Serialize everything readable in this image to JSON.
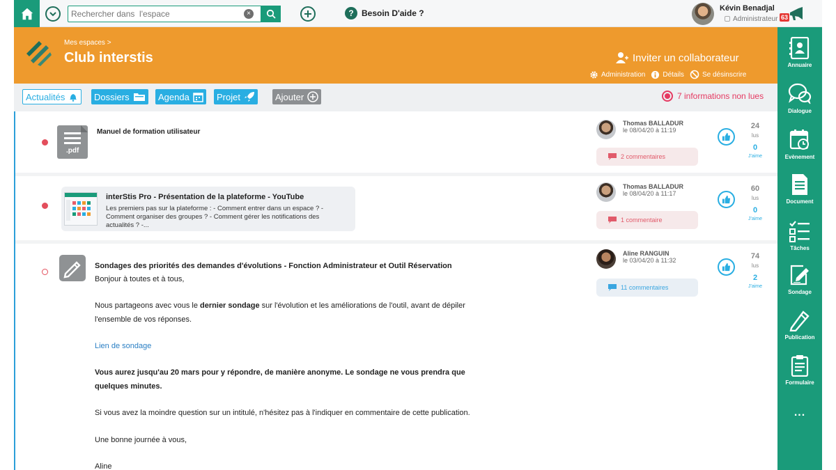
{
  "topbar": {
    "search_placeholder": "Rechercher dans  l'espace",
    "clear_symbol": "×",
    "help_symbol": "?",
    "help_label": "Besoin D'aide ?",
    "user_name": "Kévin Benadjal",
    "user_role": "Administrateur",
    "notification_count": "63"
  },
  "header": {
    "breadcrumb": "Mes espaces >",
    "title": "Club interstis",
    "invite_label": "Inviter un collaborateur",
    "links": [
      "Administration",
      "Détails",
      "Se désinscrire"
    ]
  },
  "tabs": {
    "items": [
      "Actualités",
      "Dossiers",
      "Agenda",
      "Projet",
      "Ajouter"
    ],
    "unread_label": "7 informations non lues"
  },
  "posts": [
    {
      "title": "Manuel de formation utilisateur",
      "file_ext": ".pdf",
      "author": "Thomas BALLADUR",
      "date": "le 08/04/20 à 11:19",
      "comments": "2 commentaires",
      "reads": "24",
      "reads_label": "lus",
      "likes": "0",
      "likes_label": "J'aime"
    },
    {
      "link_title": "interStis Pro - Présentation de la plateforme - YouTube",
      "link_desc": "Les premiers pas sur la plateforme : - Comment entrer dans un espace ? - Comment organiser des groupes ? - Comment gérer les notifications des actualités ? -...",
      "author": "Thomas BALLADUR",
      "date": "le 08/04/20 à 11:17",
      "comments": "1 commentaire",
      "reads": "60",
      "reads_label": "lus",
      "likes": "0",
      "likes_label": "J'aime"
    },
    {
      "title": "Sondages des priorités des demandes d'évolutions - Fonction Administrateur et Outil Réservation",
      "greeting": "Bonjour à toutes et à tous,",
      "p1_start": "Nous partageons avec vous le ",
      "p1_bold": "dernier sondage",
      "p1_end": " sur l'évolution et les améliorations de l'outil, avant de dépiler",
      "p1_line2": "l'ensemble de vos réponses.",
      "link": "Lien de sondage",
      "p2_line1": "Vous aurez jusqu'au 20 mars pour y répondre, de manière anonyme. Le sondage ne vous prendra que",
      "p2_line2": "quelques minutes.",
      "p3": "Si vous avez la moindre question sur un intitulé, n'hésitez pas à l'indiquer en commentaire de cette publication.",
      "closing": "Une bonne journée à vous,",
      "signature": "Aline",
      "author": "Aline RANGUIN",
      "date": "le 03/04/20 à 11:32",
      "comments": "11 commentaires",
      "reads": "74",
      "reads_label": "lus",
      "likes": "2",
      "likes_label": "J'aime"
    }
  ],
  "sidebar": {
    "items": [
      "Annuaire",
      "Dialogue",
      "Evènement",
      "Document",
      "Tâches",
      "Sondage",
      "Publication",
      "Formulaire"
    ],
    "more": "..."
  },
  "colors": {
    "brand_green": "#1a9b7a",
    "header_orange": "#ee9a2d",
    "accent_blue": "#29aee2",
    "unread_red": "#e53961"
  }
}
